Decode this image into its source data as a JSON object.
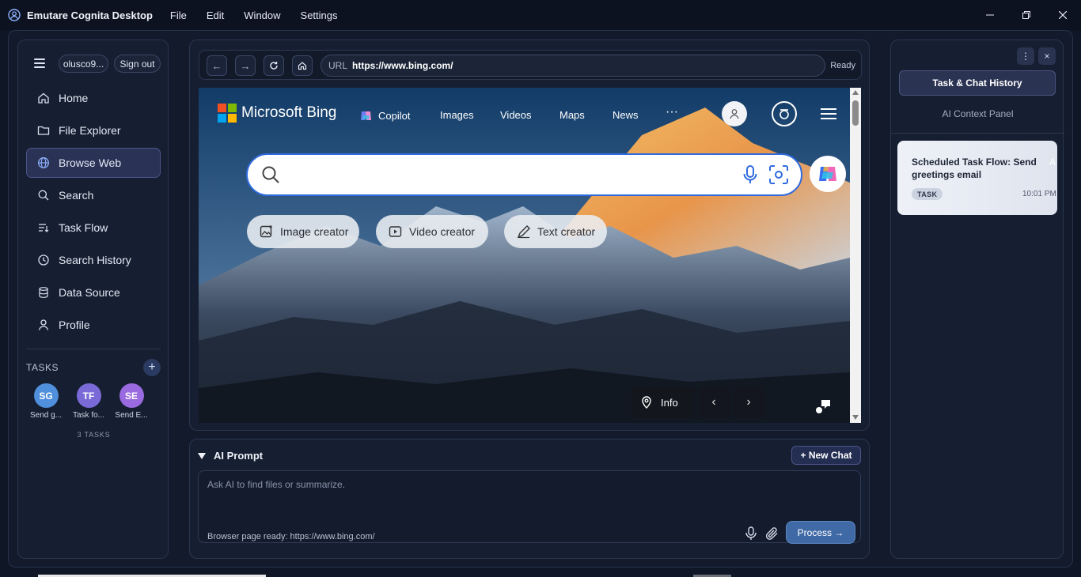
{
  "window": {
    "title": "Emutare Cognita Desktop",
    "menu": [
      "File",
      "Edit",
      "Window",
      "Settings"
    ]
  },
  "sidebar": {
    "user": "olusco9...",
    "sign_out": "Sign out",
    "items": [
      {
        "label": "Home",
        "icon": "home-icon"
      },
      {
        "label": "File Explorer",
        "icon": "folder-icon"
      },
      {
        "label": "Browse Web",
        "icon": "globe-icon",
        "active": true
      },
      {
        "label": "Search",
        "icon": "search-icon"
      },
      {
        "label": "Task Flow",
        "icon": "task-flow-icon"
      },
      {
        "label": "Search History",
        "icon": "history-icon"
      },
      {
        "label": "Data Source",
        "icon": "database-icon"
      },
      {
        "label": "Profile",
        "icon": "user-icon"
      }
    ],
    "tasks_label": "TASKS",
    "add_task": "+",
    "tasks": [
      {
        "initials": "SG",
        "label": "Send g...",
        "color": "#4f8fdc"
      },
      {
        "initials": "TF",
        "label": "Task fo...",
        "color": "#7a6ad8"
      },
      {
        "initials": "SE",
        "label": "Send E...",
        "color": "#9a6ae0"
      }
    ],
    "task_count": "3 TASKS"
  },
  "browser": {
    "back": "←",
    "forward": "→",
    "url_label": "URL",
    "url": "https://www.bing.com/",
    "status": "Ready",
    "page": {
      "brand": "Microsoft Bing",
      "nav": [
        "Copilot",
        "Images",
        "Videos",
        "Maps",
        "News"
      ],
      "more": "···",
      "chips": [
        "Image creator",
        "Video creator",
        "Text creator"
      ],
      "info": "Info",
      "prev": "‹",
      "next": "›"
    }
  },
  "prompt": {
    "title": "AI Prompt",
    "new_chat": "+ New Chat",
    "placeholder": "Ask AI to find files or summarize.",
    "status": "Browser page ready: https://www.bing.com/",
    "process": "Process →"
  },
  "right_panel": {
    "more": "⋮",
    "close": "×",
    "history_button": "Task & Chat History",
    "context_label": "AI Context Panel",
    "card": {
      "title": "Scheduled Task Flow: Send greetings email",
      "tag": "TASK",
      "time": "10:01 PM",
      "ghost": "A"
    }
  },
  "colors": {
    "accent": "#3f6aa6",
    "active_nav": "#2a3356",
    "bing_blue": "#2f6bde"
  }
}
